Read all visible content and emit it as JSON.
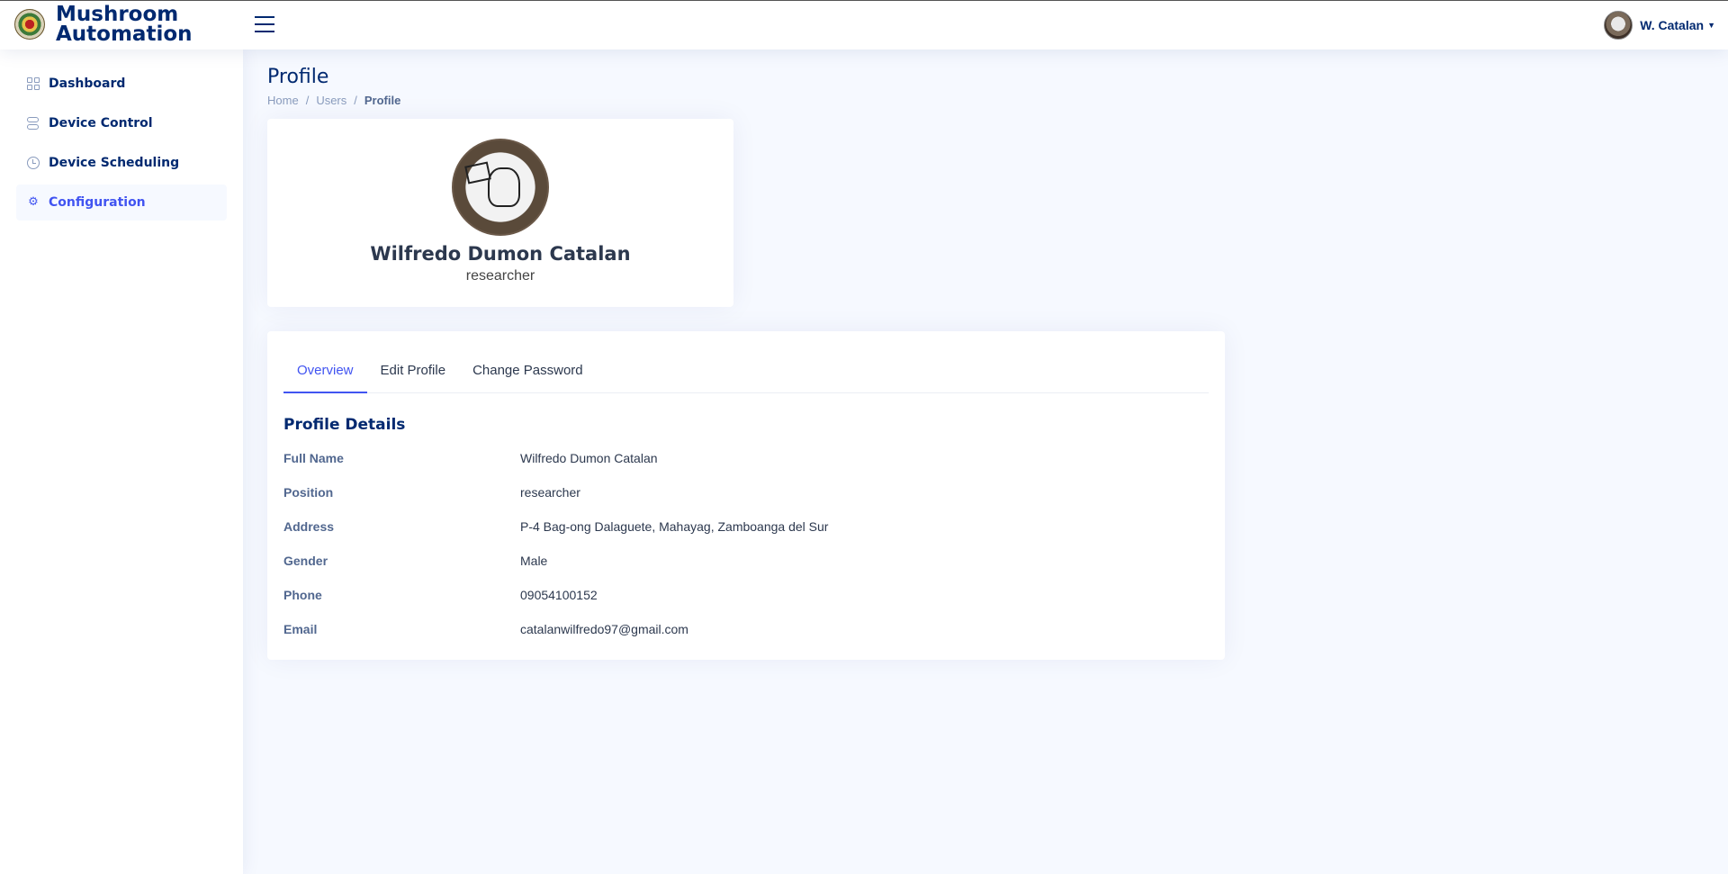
{
  "header": {
    "app_title": "Mushroom Automation",
    "user_name": "W. Catalan"
  },
  "sidebar": {
    "items": [
      {
        "label": "Dashboard",
        "icon": "grid-icon"
      },
      {
        "label": "Device Control",
        "icon": "toggles-icon"
      },
      {
        "label": "Device Scheduling",
        "icon": "clock-icon"
      },
      {
        "label": "Configuration",
        "icon": "gear-icon",
        "active": true
      }
    ]
  },
  "page": {
    "title": "Profile",
    "breadcrumb": [
      "Home",
      "Users",
      "Profile"
    ]
  },
  "profile": {
    "name": "Wilfredo Dumon Catalan",
    "role": "researcher"
  },
  "tabs": [
    "Overview",
    "Edit Profile",
    "Change Password"
  ],
  "details": {
    "section_title": "Profile Details",
    "rows": [
      {
        "label": "Full Name",
        "value": "Wilfredo Dumon Catalan"
      },
      {
        "label": "Position",
        "value": "researcher"
      },
      {
        "label": "Address",
        "value": "P-4 Bag-ong Dalaguete, Mahayag, Zamboanga del Sur"
      },
      {
        "label": "Gender",
        "value": "Male"
      },
      {
        "label": "Phone",
        "value": "09054100152"
      },
      {
        "label": "Email",
        "value": "catalanwilfredo97@gmail.com"
      }
    ]
  },
  "colors": {
    "brand": "#012970",
    "accent": "#4154f1",
    "background": "#f6f9ff"
  }
}
